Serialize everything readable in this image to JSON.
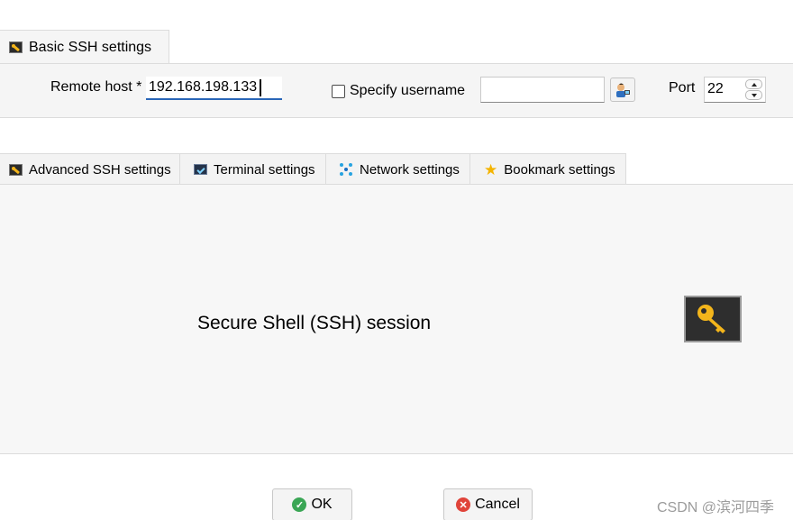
{
  "basic_tab": {
    "label": "Basic SSH settings",
    "icon": "ssh-key-icon"
  },
  "basic": {
    "remote_host_label": "Remote host *",
    "remote_host_value": "192.168.198.133",
    "specify_username_label": "Specify username",
    "specify_username_checked": false,
    "username_value": "",
    "port_label": "Port",
    "port_value": "22"
  },
  "tabs": [
    {
      "label": "Advanced SSH settings",
      "icon": "ssh-key-icon"
    },
    {
      "label": "Terminal settings",
      "icon": "terminal-icon"
    },
    {
      "label": "Network settings",
      "icon": "network-icon"
    },
    {
      "label": "Bookmark settings",
      "icon": "star-icon"
    }
  ],
  "main": {
    "session_title": "Secure Shell (SSH) session",
    "icon": "key-icon"
  },
  "buttons": {
    "ok_label": "OK",
    "cancel_label": "Cancel"
  },
  "watermark": "CSDN @滨河四季",
  "colors": {
    "accent": "#2a66b8",
    "key": "#f3b51b",
    "ok": "#3aa655",
    "cancel": "#e0443a"
  }
}
